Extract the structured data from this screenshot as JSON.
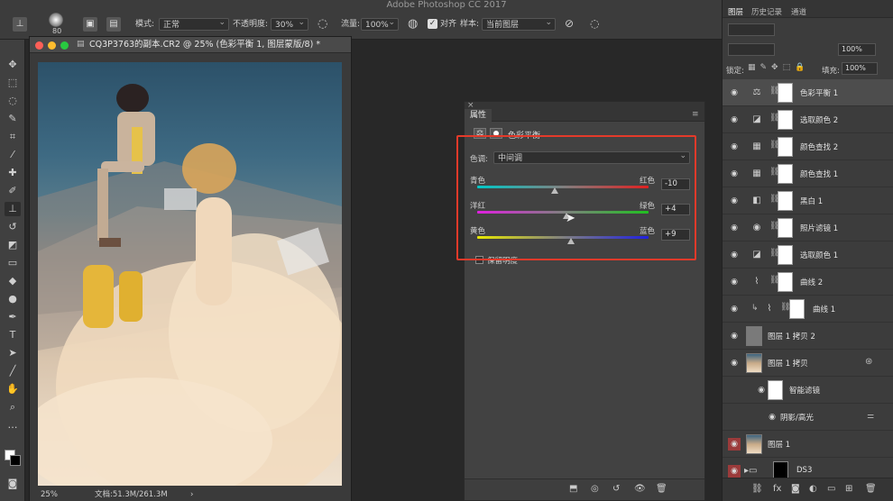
{
  "app": {
    "title": "Adobe Photoshop CC 2017"
  },
  "options_bar": {
    "brush_size": "80",
    "mode_label": "模式:",
    "mode_value": "正常",
    "opacity_label": "不透明度:",
    "opacity_value": "30%",
    "flow_label": "流量:",
    "flow_value": "100%",
    "align_label": "对齐",
    "sample_label": "样本:",
    "sample_value": "当前图层"
  },
  "document": {
    "title": "CQ3P3763的副本.CR2 @ 25% (色彩平衡 1, 图层蒙版/8) *",
    "zoom": "25%",
    "doc_info": "文档:51.3M/261.3M"
  },
  "properties": {
    "tab_label": "属性",
    "panel_title": "色彩平衡",
    "tone_label": "色调:",
    "tone_value": "中间调",
    "sliders": [
      {
        "left": "青色",
        "right": "红色",
        "value": "-10",
        "track": "linear-gradient(90deg,#00c8c8,#808080,#e02020)",
        "level": 0.45
      },
      {
        "left": "洋红",
        "right": "绿色",
        "value": "+4",
        "track": "linear-gradient(90deg,#e020e0,#808080,#20c020)",
        "level": 0.52
      },
      {
        "left": "黄色",
        "right": "蓝色",
        "value": "+9",
        "track": "linear-gradient(90deg,#e8e800,#808080,#2020e0)",
        "level": 0.545
      }
    ],
    "preserve_luminosity": "保留明度"
  },
  "layers_panel": {
    "tabs": [
      "图层",
      "历史记录",
      "通道"
    ],
    "lock_label": "锁定:",
    "fill_label": "填充:",
    "fill_value": "100%",
    "opacity_value": "100%",
    "layers": [
      {
        "name": "色彩平衡 1",
        "icon": "balance-icon",
        "glyph": "⚖",
        "mask": true,
        "selected": true
      },
      {
        "name": "选取颜色 2",
        "icon": "selective-color-icon",
        "glyph": "◪",
        "mask": true
      },
      {
        "name": "颜色查找 2",
        "icon": "color-lookup-icon",
        "glyph": "▦",
        "mask": true
      },
      {
        "name": "颜色查找 1",
        "icon": "color-lookup-icon",
        "glyph": "▦",
        "mask": true
      },
      {
        "name": "黑白 1",
        "icon": "black-white-icon",
        "glyph": "◧",
        "mask": true
      },
      {
        "name": "照片滤镜 1",
        "icon": "photo-filter-icon",
        "glyph": "◉",
        "mask": true
      },
      {
        "name": "选取颜色 1",
        "icon": "selective-color-icon",
        "glyph": "◪",
        "mask": true
      },
      {
        "name": "曲线 2",
        "icon": "curves-icon",
        "glyph": "⌇",
        "mask": true
      },
      {
        "name": "曲线 1",
        "icon": "curves-icon",
        "glyph": "⌇",
        "mask": true,
        "clipped": true
      },
      {
        "name": "图层 1 拷贝 2",
        "icon": "gray-layer-icon",
        "glyph": "",
        "mask": false
      },
      {
        "name": "图层 1 拷贝",
        "icon": "photo-thumb-icon",
        "glyph": "",
        "mask": false,
        "smart": true
      },
      {
        "name": "智能滤镜",
        "icon": "smart-filter-icon",
        "glyph": "",
        "mask": true,
        "sub": true
      },
      {
        "name": "阴影/高光",
        "icon": "",
        "glyph": "",
        "mask": false,
        "filter": true
      },
      {
        "name": "图层 1",
        "icon": "photo-thumb-icon",
        "glyph": "",
        "mask": false,
        "redeye": true
      },
      {
        "name": "DS3",
        "icon": "folder-icon",
        "glyph": "",
        "mask": false,
        "redeye": true,
        "folder": true
      }
    ]
  },
  "colors": {
    "accent_red": "#e43a2a",
    "panel_bg": "#3c3c3c"
  }
}
